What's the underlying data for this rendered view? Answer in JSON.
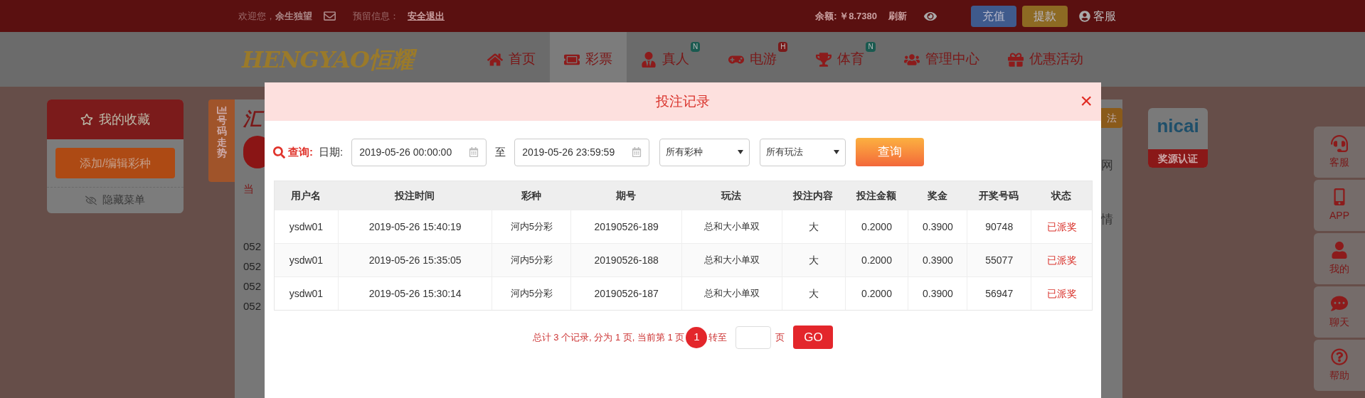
{
  "top_bar": {
    "welcome": "欢迎您，",
    "username": "余生独望",
    "reserved_label": "预留信息：",
    "logout": "安全退出",
    "balance": "余额: ￥8.7380",
    "refresh": "刷新",
    "buttons": [
      {
        "label": "充值",
        "kind": "deposit"
      },
      {
        "label": "提款",
        "kind": "withdraw"
      }
    ],
    "service": "客服"
  },
  "nav": {
    "logo": "HENGYAO恒耀",
    "items": [
      {
        "label": "首页",
        "selected": false
      },
      {
        "label": "彩票",
        "selected": true
      },
      {
        "label": "真人",
        "selected": false,
        "badge": "N"
      },
      {
        "label": "电游",
        "selected": false,
        "badge": "H"
      },
      {
        "label": "体育",
        "selected": false,
        "badge": "N"
      },
      {
        "label": "管理中心",
        "selected": false
      },
      {
        "label": "优惠活动",
        "selected": false
      }
    ]
  },
  "favorites": {
    "title": "我的收藏",
    "add_button": "添加/编辑彩种",
    "hide_menu": "隐藏菜单"
  },
  "trend_tab": "号码走势",
  "background_page": {
    "title": "汇",
    "current": "当",
    "right_button": "法",
    "right_text_1": "网",
    "right_text_2": "情",
    "rows": [
      "052",
      "052",
      "052",
      "052"
    ]
  },
  "certification": {
    "logo": "nicai",
    "label": "奖源认证"
  },
  "right_sidebar": [
    {
      "label": "客服"
    },
    {
      "label": "APP"
    },
    {
      "label": "我的"
    },
    {
      "label": "聊天"
    },
    {
      "label": "帮助"
    }
  ],
  "modal": {
    "title": "投注记录",
    "close": "×",
    "query": {
      "label": "查询:",
      "date_label": "日期:",
      "start": "2019-05-26 00:00:00",
      "to": "至",
      "end": "2019-05-26 23:59:59",
      "lottery_select": "所有彩种",
      "play_select": "所有玩法",
      "button": "查询"
    },
    "table": {
      "columns": [
        "用户名",
        "投注时间",
        "彩种",
        "期号",
        "玩法",
        "投注内容",
        "投注金额",
        "奖金",
        "开奖号码",
        "状态"
      ],
      "rows": [
        [
          "ysdw01",
          "2019-05-26 15:40:19",
          "河内5分彩",
          "20190526-189",
          "总和大小单双",
          "大",
          "0.2000",
          "0.3900",
          "90748",
          "已派奖"
        ],
        [
          "ysdw01",
          "2019-05-26 15:35:05",
          "河内5分彩",
          "20190526-188",
          "总和大小单双",
          "大",
          "0.2000",
          "0.3900",
          "55077",
          "已派奖"
        ],
        [
          "ysdw01",
          "2019-05-26 15:30:14",
          "河内5分彩",
          "20190526-187",
          "总和大小单双",
          "大",
          "0.2000",
          "0.3900",
          "56947",
          "已派奖"
        ]
      ]
    },
    "pagination": {
      "summary": "总计 3 个记录, 分为 1 页, 当前第 1 页",
      "pages": [
        {
          "label": "1",
          "selected": true
        }
      ],
      "goto": "转至",
      "page_unit": "页",
      "go": "GO"
    }
  }
}
